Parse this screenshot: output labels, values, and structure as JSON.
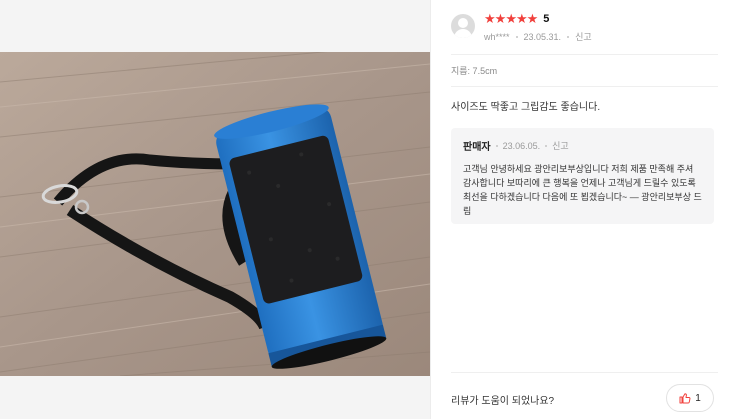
{
  "review": {
    "rating_value": 5,
    "rating_label": "5",
    "stars": [
      "★",
      "★",
      "★",
      "★",
      "★"
    ],
    "reviewer_id": "wh****",
    "date": "23.05.31.",
    "report_label": "신고",
    "option_text": "지름: 7.5cm",
    "body": "사이즈도 딱좋고 그립감도 좋습니다."
  },
  "seller_reply": {
    "label": "판매자",
    "date": "23.06.05.",
    "report_label": "신고",
    "text": "고객님 안녕하세요 광안리보부상입니다 저희 제품 만족해 주셔 감사합니다 보따리에 큰 행복을 언제나 고객님게 드릴수 있도록 최선을 다하겠습니다 다음에 또 뵙겠습니다~ — 광안리보부상 드림"
  },
  "footer": {
    "helpful_question": "리뷰가 도움이 되었나요?",
    "like_count": "1"
  },
  "colors": {
    "star": "#f1403c",
    "reply_bg": "#f5f5f6",
    "like_icon": "#f1403c",
    "product_blue": "#2f86d8"
  },
  "icons": {
    "like": "thumbs-up-icon",
    "avatar": "default-profile-icon"
  }
}
